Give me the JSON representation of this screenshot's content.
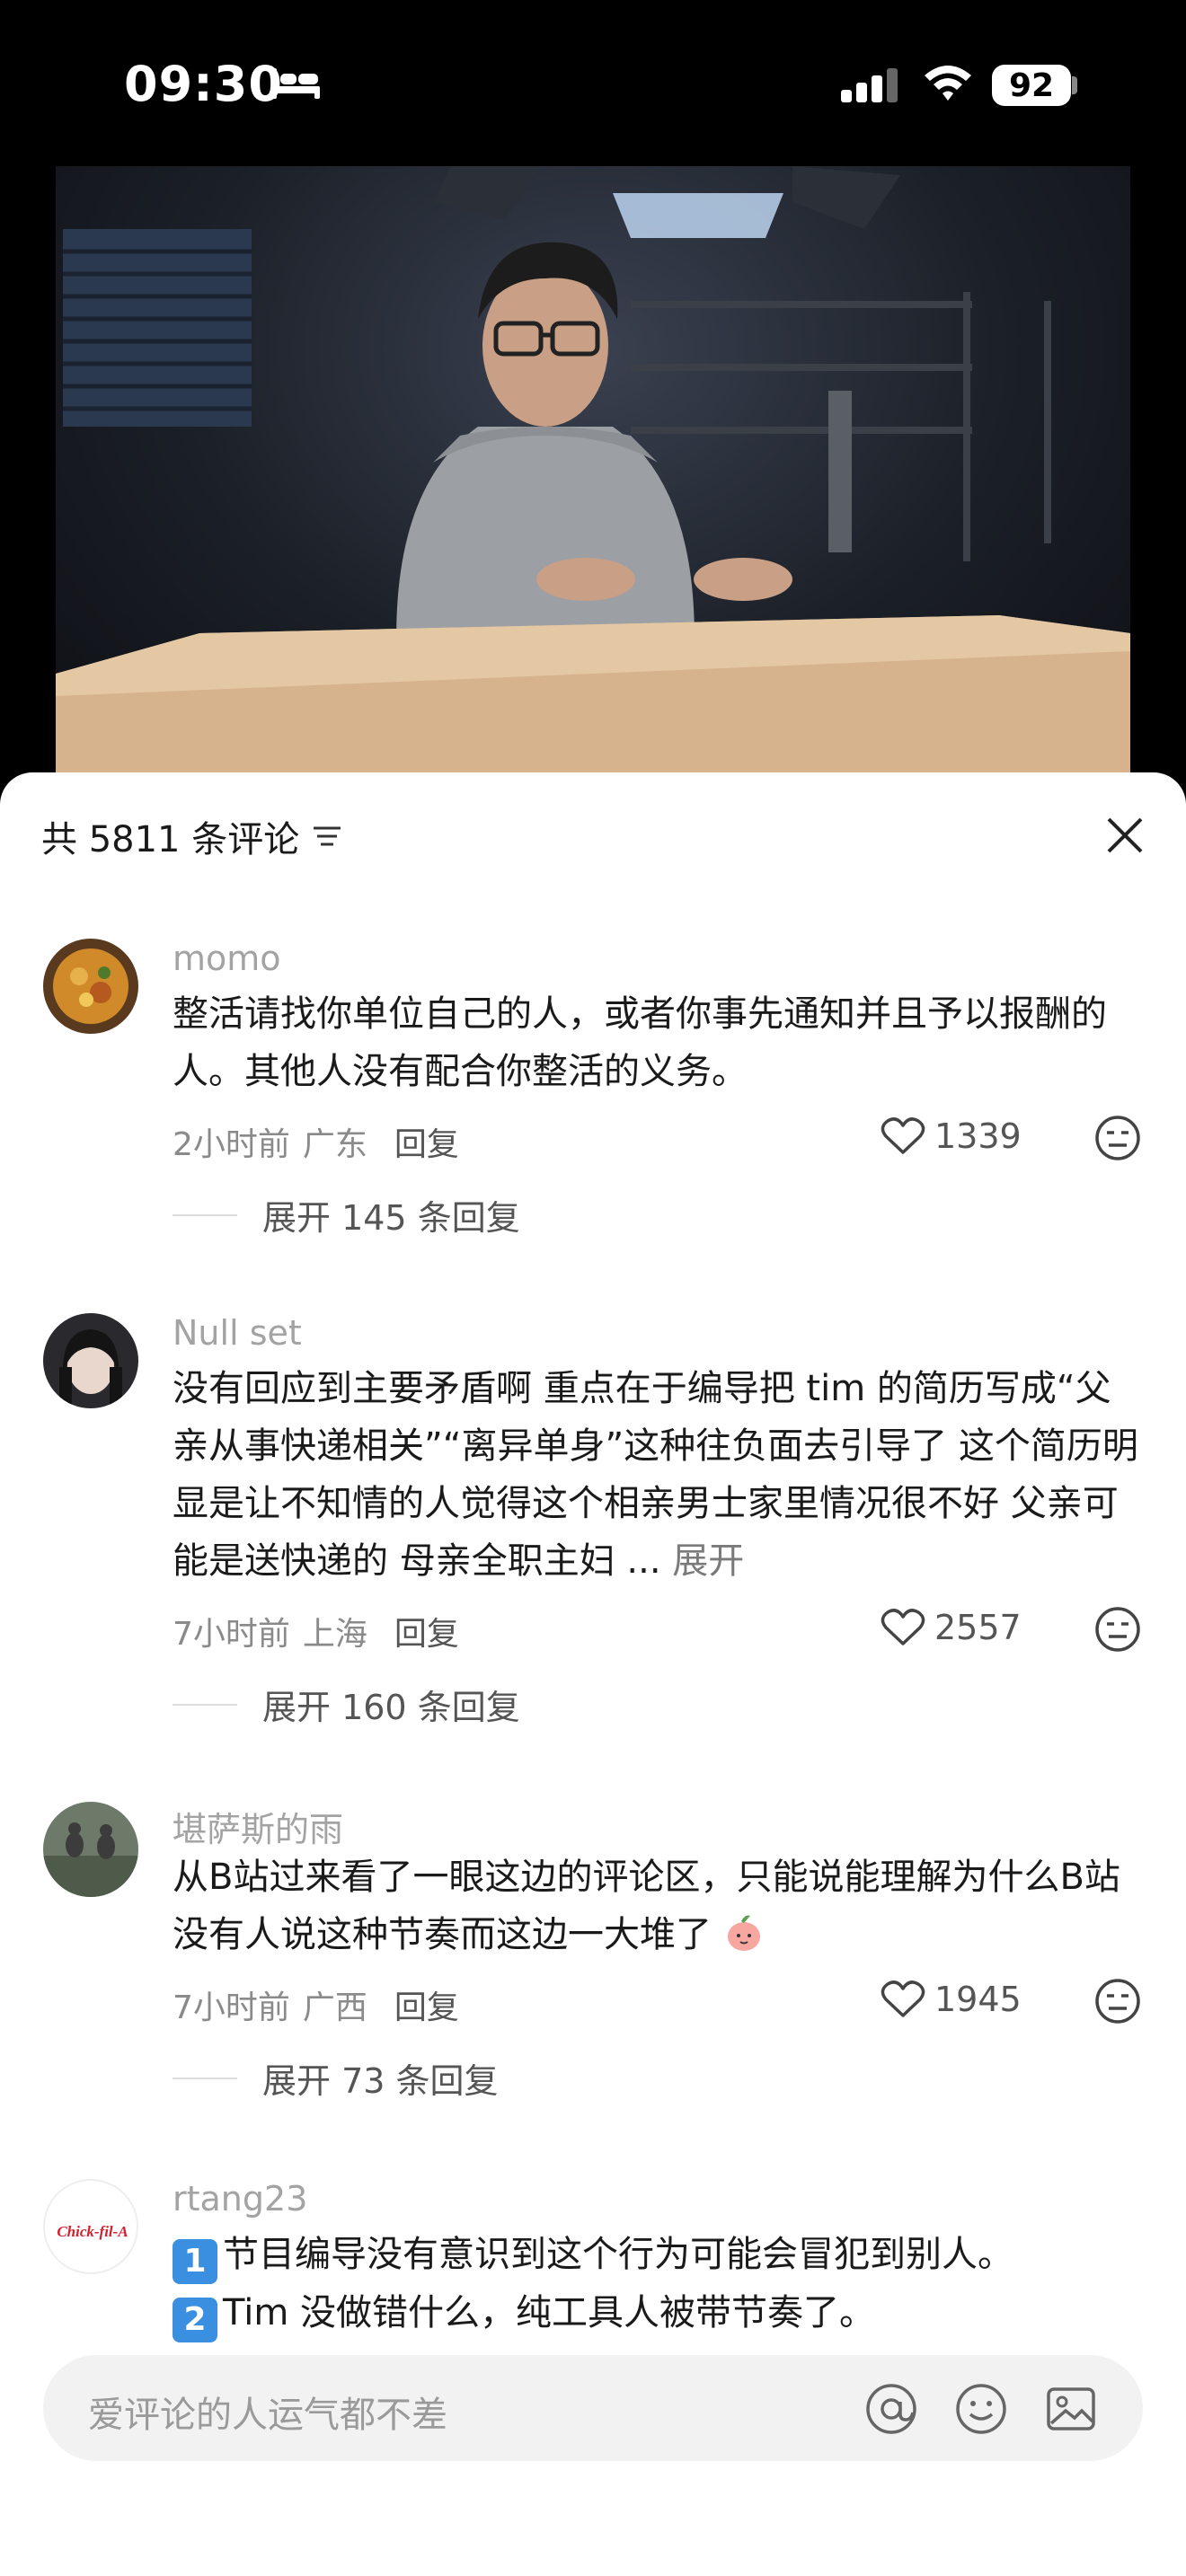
{
  "status_bar": {
    "time": "09:30",
    "battery": "92"
  },
  "comments_header": {
    "title": "共 5811 条评论"
  },
  "comments": [
    {
      "username": "momo",
      "text": "整活请找你单位自己的人，或者你事先通知并且予以报酬的人。其他人没有配合你整活的义务。",
      "time": "2小时前",
      "location": "广东",
      "reply_label": "回复",
      "likes": "1339",
      "expand_replies": "展开 145 条回复"
    },
    {
      "username": "Null set",
      "text": "没有回应到主要矛盾啊 重点在于编导把 tim 的简历写成“父亲从事快递相关”“离异单身”这种往负面去引导了 这个简历明显是让不知情的人觉得这个相亲男士家里情况很不好 父亲可能是送快递的 母亲全职主妇 ...",
      "expand_label": "展开",
      "time": "7小时前",
      "location": "上海",
      "reply_label": "回复",
      "likes": "2557",
      "expand_replies": "展开 160 条回复"
    },
    {
      "username": "堪萨斯的雨",
      "text": "从B站过来看了一眼这边的评论区，只能说能理解为什么B站没有人说这种节奏而这边一大堆了",
      "time": "7小时前",
      "location": "广西",
      "reply_label": "回复",
      "likes": "1945",
      "expand_replies": "展开 73 条回复"
    },
    {
      "username": "rtang23",
      "line1_badge": "1",
      "line1": "节目编导没有意识到这个行为可能会冒犯到别人。",
      "line2_badge": "2",
      "line2": "Tim 没做错什么，纯工具人被带节奏了。",
      "avatar_logo_text": "Chick-fil-A"
    }
  ],
  "input": {
    "placeholder": "爱评论的人运气都不差"
  }
}
